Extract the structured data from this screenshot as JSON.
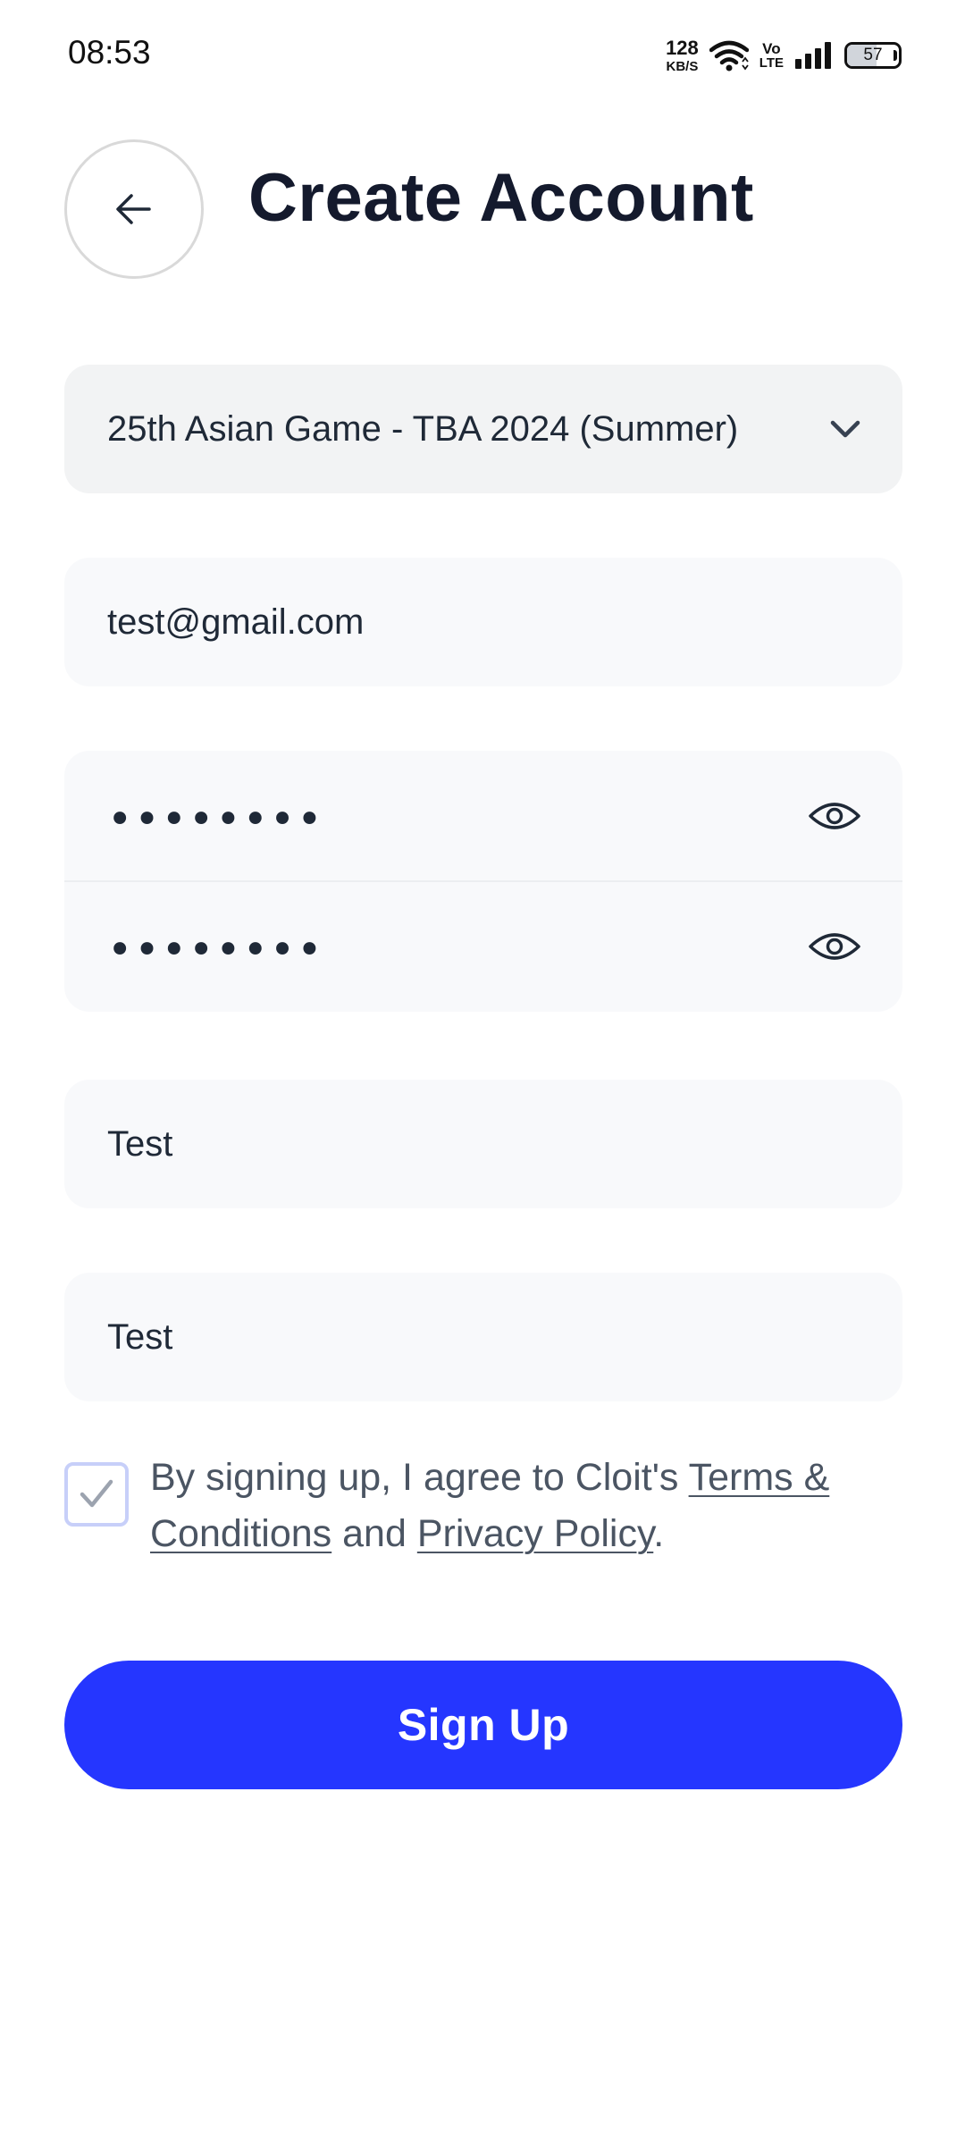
{
  "status_bar": {
    "time": "08:53",
    "net_speed_value": "128",
    "net_speed_unit": "KB/S",
    "volte_top": "Vo",
    "volte_bottom": "LTE",
    "battery_level": "57"
  },
  "header": {
    "title": "Create Account"
  },
  "form": {
    "event_select": {
      "value": "25th Asian Game - TBA 2024 (Summer)"
    },
    "email": {
      "value": "test@gmail.com"
    },
    "password": {
      "masked": "••••••••"
    },
    "confirm_password": {
      "masked": "••••••••"
    },
    "first_name": {
      "value": "Test"
    },
    "last_name": {
      "value": "Test"
    },
    "agreement": {
      "checked": true,
      "prefix": "By signing up, I agree to Cloit's ",
      "terms_link": "Terms & Conditions",
      "middle": " and ",
      "privacy_link": "Privacy Policy",
      "suffix": "."
    },
    "signup_label": "Sign Up"
  },
  "colors": {
    "accent": "#2536ff",
    "title": "#141a2d",
    "field_bg": "#f8f9fb",
    "select_bg": "#f2f3f4",
    "checkbox_border": "#c7cff9"
  },
  "icons": {
    "back": "arrow-left-icon",
    "select": "chevron-down-icon",
    "password_toggle": "eye-icon",
    "check": "check-icon"
  }
}
